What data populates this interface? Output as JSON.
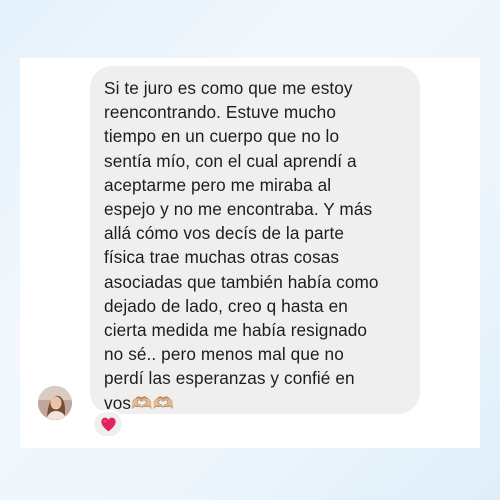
{
  "message": {
    "text": "Si te juro es como que me estoy\nreencontrando. Estuve mucho\ntiempo en un cuerpo que no lo\nsentía mío, con el cual aprendí a\naceptarme pero me miraba al\nespejo y no me encontraba. Y más\nallá cómo vos decís de la parte\nfísica trae muchas otras cosas\nasociadas que también había como\ndejado de lado, creo q hasta en\ncierta medida me había resignado\nno sé.. pero menos mal que no\nperdí las esperanzas y confié en\nvos🫶🏼🫶🏼",
    "bubble_color": "#efefef",
    "text_color": "#1d1d1d"
  },
  "reaction": {
    "icon": "red-heart-icon",
    "color": "#e0245e"
  },
  "sender": {
    "avatar_icon": "profile-photo-avatar"
  },
  "colors": {
    "background": "#e9f3fb",
    "card": "#ffffff"
  }
}
